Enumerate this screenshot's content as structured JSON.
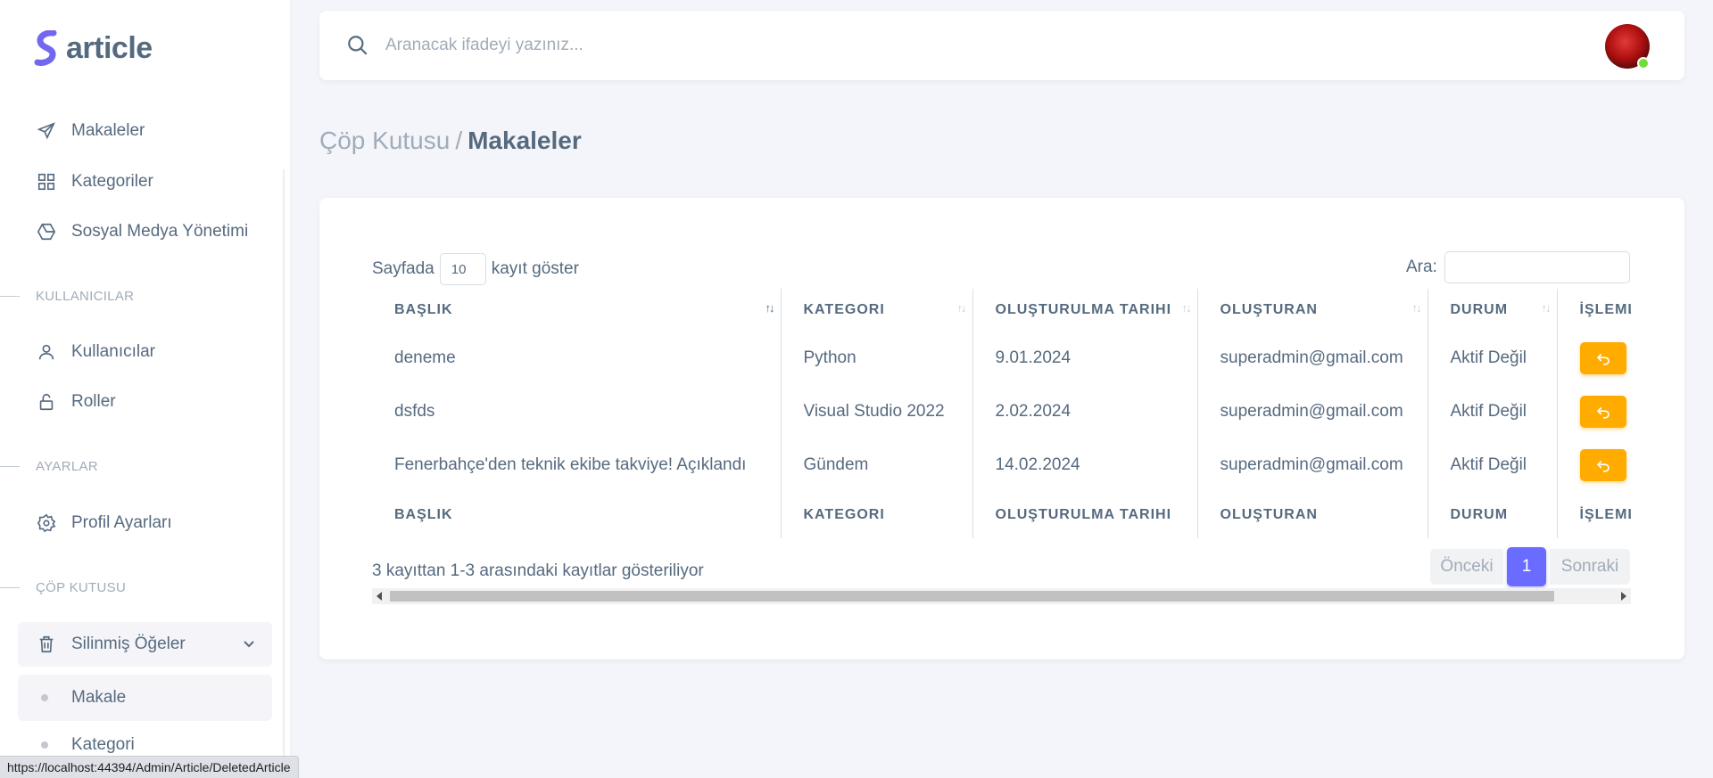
{
  "brand": {
    "name": "article"
  },
  "sidebar": {
    "items": [
      {
        "label": "Makaleler",
        "icon": "send-icon"
      },
      {
        "label": "Kategoriler",
        "icon": "grid-icon"
      },
      {
        "label": "Sosyal Medya Yönetimi",
        "icon": "hexagon-icon"
      }
    ],
    "sections": {
      "users": "KULLANICILAR",
      "settings": "AYARLAR",
      "trash": "ÇÖP KUTUSU"
    },
    "user_items": [
      {
        "label": "Kullanıcılar",
        "icon": "user-icon"
      },
      {
        "label": "Roller",
        "icon": "lock-icon"
      }
    ],
    "settings_items": [
      {
        "label": "Profil Ayarları",
        "icon": "gear-icon"
      }
    ],
    "trash_menu": {
      "label": "Silinmiş Öğeler",
      "icon": "trash-icon",
      "children": [
        {
          "label": "Makale",
          "active": true
        },
        {
          "label": "Kategori",
          "active": false
        }
      ]
    }
  },
  "status_url": "https://localhost:44394/Admin/Article/DeletedArticle",
  "search": {
    "placeholder": "Aranacak ifadeyi yazınız..."
  },
  "breadcrumb": {
    "parent": "Çöp Kutusu",
    "separator": "/",
    "current": "Makaleler"
  },
  "table_controls": {
    "length_prefix": "Sayfada",
    "length_value": "10",
    "length_suffix": "kayıt göster",
    "filter_label": "Ara:"
  },
  "table": {
    "columns": [
      "BAŞLIK",
      "KATEGORI",
      "OLUŞTURULMA TARIHI",
      "OLUŞTURAN",
      "DURUM",
      "İŞLEMLER"
    ],
    "rows": [
      {
        "title": "deneme",
        "category": "Python",
        "created": "9.01.2024",
        "author": "superadmin@gmail.com",
        "status": "Aktif Değil"
      },
      {
        "title": "dsfds",
        "category": "Visual Studio 2022",
        "created": "2.02.2024",
        "author": "superadmin@gmail.com",
        "status": "Aktif Değil"
      },
      {
        "title": "Fenerbahçe'den teknik ekibe takviye! Açıklandı",
        "category": "Gündem",
        "created": "14.02.2024",
        "author": "superadmin@gmail.com",
        "status": "Aktif Değil"
      }
    ]
  },
  "info": "3 kayıttan 1-3 arasındaki kayıtlar gösteriliyor",
  "pager": {
    "prev": "Önceki",
    "current": "1",
    "next": "Sonraki"
  },
  "colors": {
    "primary": "#696cff",
    "warning": "#ffab00",
    "text": "#566a7f",
    "muted": "#a1acb8",
    "online": "#71dd37"
  }
}
